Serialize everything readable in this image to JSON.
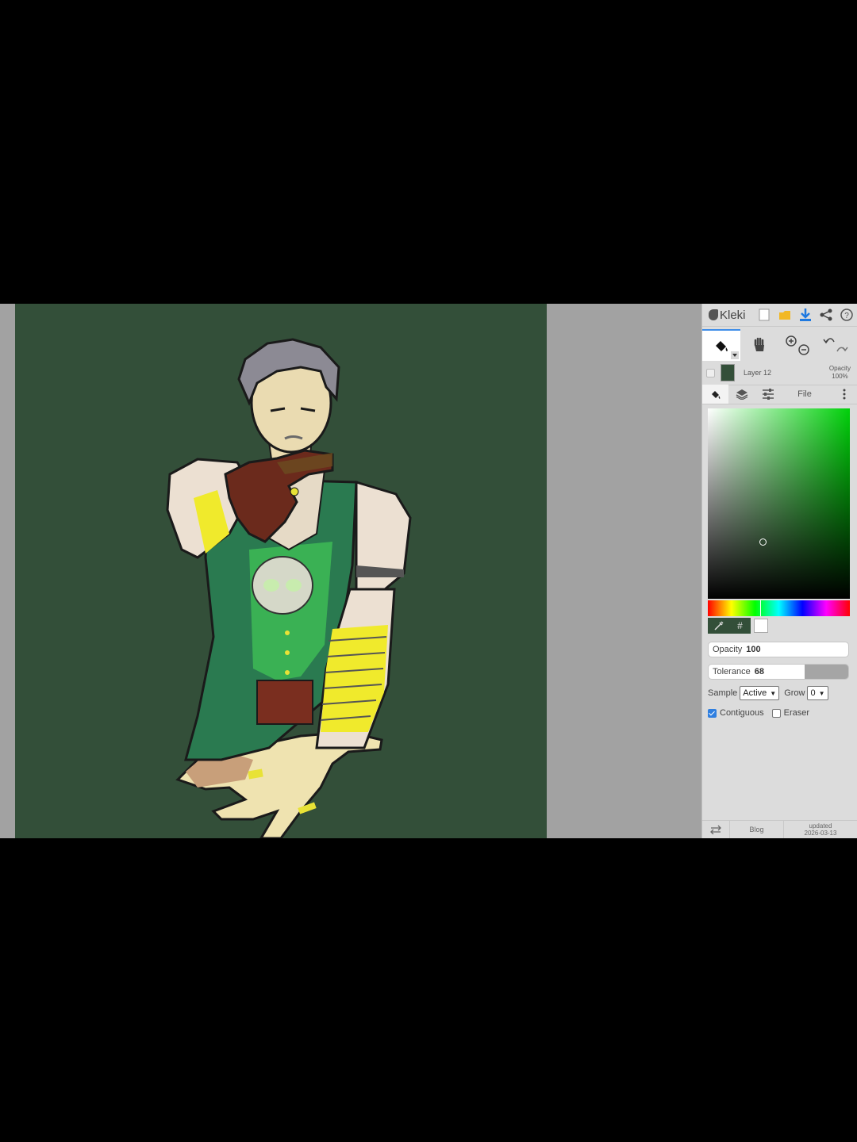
{
  "app": {
    "name": "Kleki"
  },
  "layer": {
    "name": "Layer 12",
    "opacity_label": "Opacity",
    "opacity_value": "100%"
  },
  "tabs": {
    "file_label": "File"
  },
  "colors": {
    "canvas_bg": "#334f39",
    "accent": "#3f8ee8",
    "primary_color": "#334f39",
    "secondary_color": "#ffffff"
  },
  "color_picker": {
    "hue_fraction": 0.37,
    "hex_symbol": "#"
  },
  "fill_tool": {
    "opacity_label": "Opacity",
    "opacity_value": "100",
    "tolerance_label": "Tolerance",
    "tolerance_value": "68",
    "sample_label": "Sample",
    "sample_value": "Active",
    "grow_label": "Grow",
    "grow_value": "0",
    "contiguous_label": "Contiguous",
    "contiguous_checked": true,
    "eraser_label": "Eraser",
    "eraser_checked": false
  },
  "footer": {
    "blog_label": "Blog",
    "updated_label": "updated",
    "updated_date": "2026-03-13"
  },
  "icons": [
    "new-image-icon",
    "open-folder-icon",
    "download-icon",
    "share-icon",
    "help-icon",
    "paint-bucket-icon",
    "hand-icon",
    "zoom-in-icon",
    "zoom-out-icon",
    "undo-icon",
    "redo-icon",
    "layers-icon",
    "adjust-icon",
    "more-icon",
    "eyedropper-icon",
    "swap-icon"
  ]
}
